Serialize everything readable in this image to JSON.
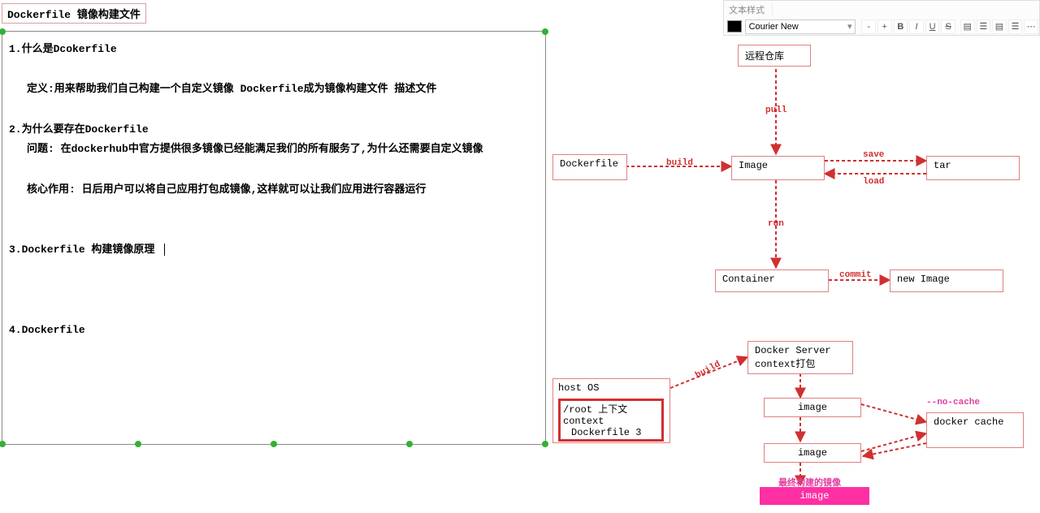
{
  "title": "Dockerfile  镜像构建文件",
  "toolbar": {
    "group_label": "文本样式",
    "font": "Courier New"
  },
  "editor": {
    "s1_h": "1.什么是Dcokerfile",
    "s1_l1": "定义:用来帮助我们自己构建一个自定义镜像  Dockerfile成为镜像构建文件 描述文件",
    "s2_h": "2.为什么要存在Dockerfile",
    "s2_l1": "问题: 在dockerhub中官方提供很多镜像已经能满足我们的所有服务了,为什么还需要自定义镜像",
    "s2_l2": "核心作用: 日后用户可以将自己应用打包成镜像,这样就可以让我们应用进行容器运行",
    "s3_h": "3.Dockerfile 构建镜像原理",
    "s4_h": "4.Dockerfile"
  },
  "diagram": {
    "remote_repo": "远程仓库",
    "dockerfile": "Dockerfile",
    "image": "Image",
    "tar": "tar",
    "container": "Container",
    "new_image": "new Image",
    "host_os": "host OS",
    "root_ctx_l1": "/root 上下文context",
    "root_ctx_l2": "Dockerfile 3",
    "docker_server_l1": "Docker Server",
    "docker_server_l2": "context打包",
    "image_step1": "image",
    "image_step2": "image",
    "docker_cache": "docker cache",
    "final_label": "最终构建的镜像",
    "final_image": "image",
    "edge_pull": "pull",
    "edge_build": "build",
    "edge_save": "save",
    "edge_load": "load",
    "edge_run": "run",
    "edge_commit": "commit",
    "edge_build2": "build",
    "edge_nocache": "--no-cache"
  }
}
